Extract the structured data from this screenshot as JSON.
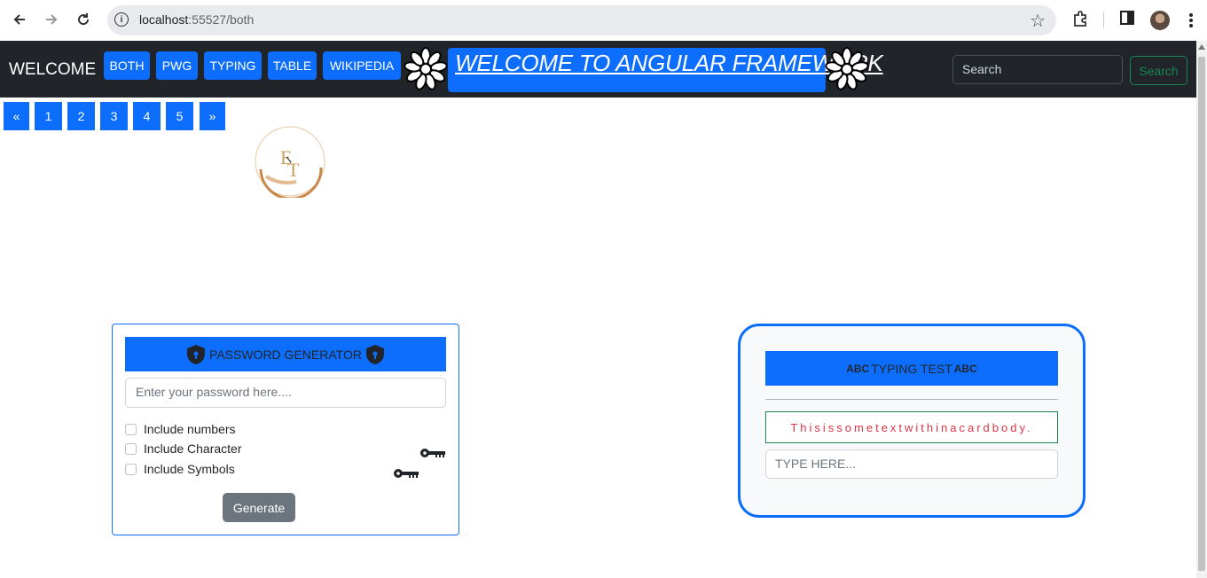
{
  "browser": {
    "url_host": "localhost",
    "url_path": ":55527/both"
  },
  "navbar": {
    "brand": "WELCOME",
    "links": [
      "BOTH",
      "PWG",
      "TYPING",
      "TABLE",
      "WIKIPEDIA"
    ],
    "title": "WELCOME TO ANGULAR FRAMEWORK",
    "search_placeholder": "Search",
    "search_button": "Search"
  },
  "pagination": {
    "prev": "«",
    "pages": [
      "1",
      "2",
      "3",
      "4",
      "5"
    ],
    "next": "»"
  },
  "password_card": {
    "title": "PASSWORD GENERATOR",
    "input_placeholder": "Enter your password here....",
    "options": [
      "Include numbers",
      "Include Character",
      "Include Symbols"
    ],
    "generate_label": "Generate"
  },
  "typing_card": {
    "prefix": "ABC",
    "title": "TYPING TEST",
    "suffix": "ABC",
    "sample_text": "Thisissometextwithinacardbody.",
    "input_placeholder": "TYPE HERE..."
  },
  "colors": {
    "primary": "#0d6efd",
    "navbar_bg": "#212529",
    "success": "#198754",
    "danger": "#dc3545",
    "secondary": "#6c757d"
  }
}
